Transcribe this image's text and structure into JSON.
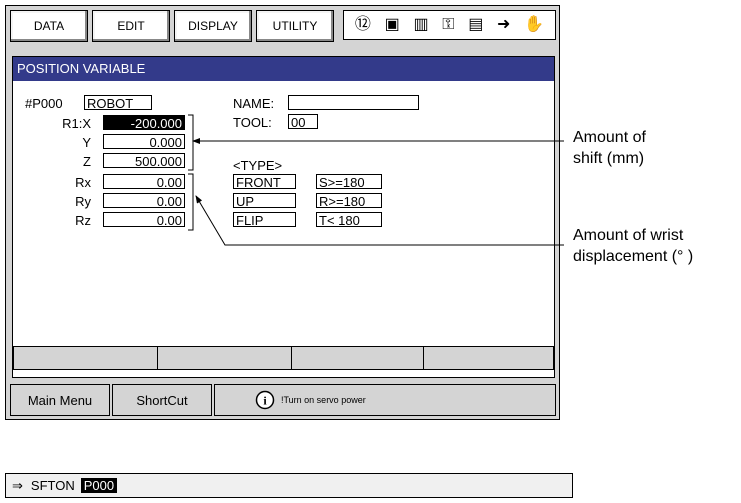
{
  "menu": {
    "data": "DATA",
    "edit": "EDIT",
    "display": "DISPLAY",
    "utility": "UTILITY"
  },
  "icons": [
    "pendant-icon",
    "monitor-icon",
    "job-icon",
    "key-icon",
    "io-icon",
    "cursor-arrow-icon",
    "hand-icon"
  ],
  "window": {
    "title": "POSITION VARIABLE",
    "var_id": "#P000",
    "group": "ROBOT",
    "name_label": "NAME:",
    "name_value": "",
    "tool_label": "TOOL:",
    "tool_value": "00",
    "type_label": "<TYPE>",
    "coords": [
      {
        "label": "R1:X",
        "value": "-200.000"
      },
      {
        "label": "Y",
        "value": "0.000"
      },
      {
        "label": "Z",
        "value": "500.000"
      },
      {
        "label": "Rx",
        "value": "0.00"
      },
      {
        "label": "Ry",
        "value": "0.00"
      },
      {
        "label": "Rz",
        "value": "0.00"
      }
    ],
    "type_rows": [
      {
        "mode": "FRONT",
        "cond": "S>=180"
      },
      {
        "mode": "UP",
        "cond": "R>=180"
      },
      {
        "mode": "FLIP",
        "cond": "T< 180"
      }
    ]
  },
  "bottom": {
    "main_menu": "Main Menu",
    "shortcut": "ShortCut",
    "message": "!Turn on servo power"
  },
  "annotations": {
    "shift_line1": "Amount of",
    "shift_line2": "shift (mm)",
    "wrist_line1": "Amount of wrist",
    "wrist_line2": "displacement (°  )"
  },
  "command": {
    "arrow": "⇒",
    "instr": "SFTON",
    "arg": "P000"
  }
}
